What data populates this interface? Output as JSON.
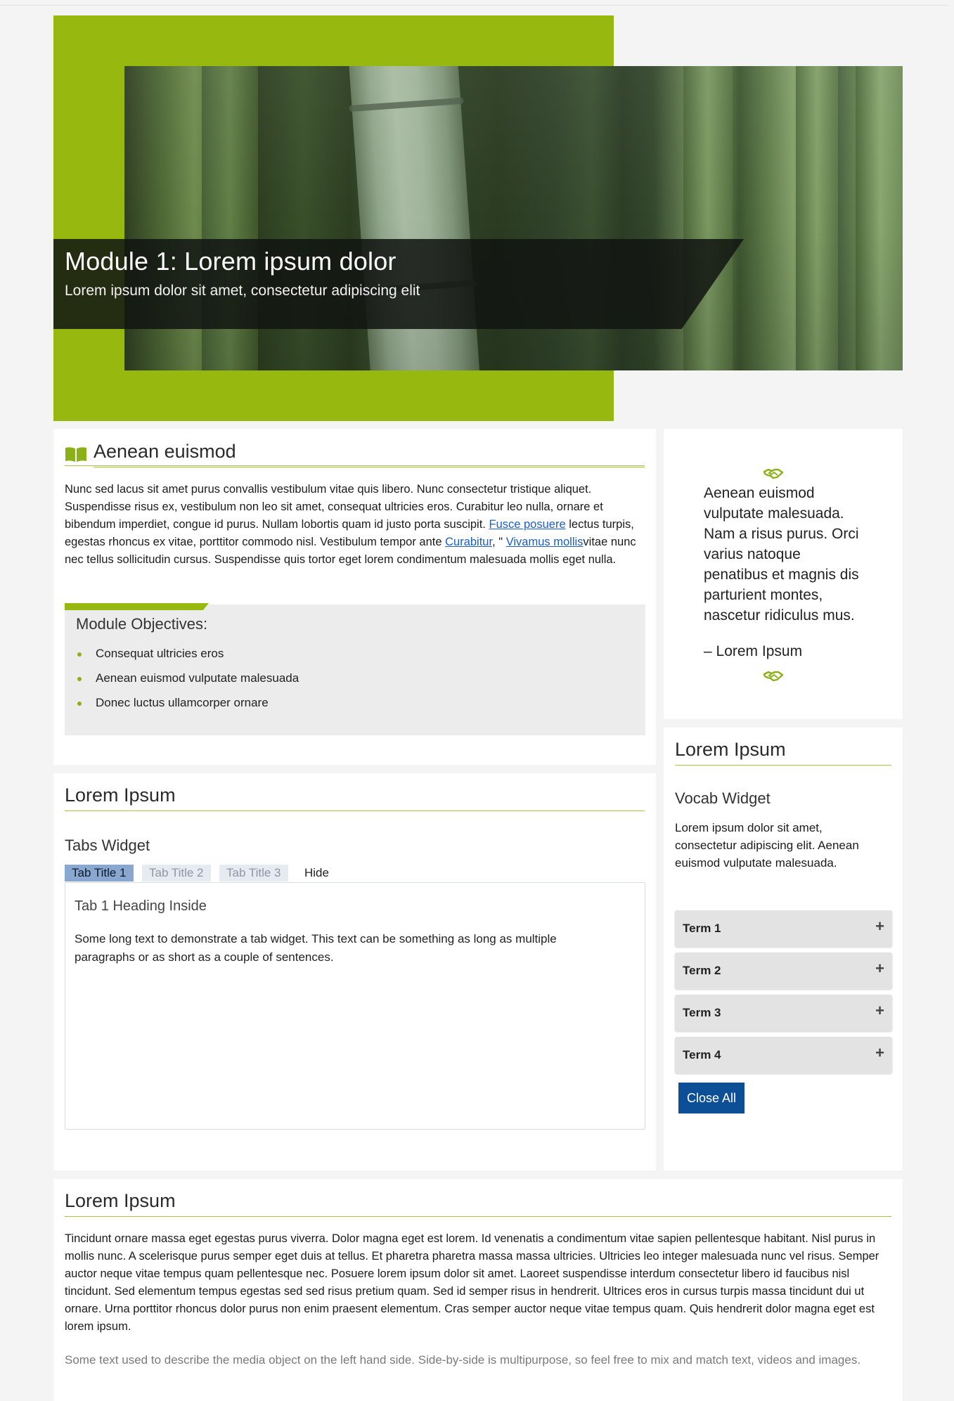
{
  "banner": {
    "title": "Module 1: Lorem ipsum dolor",
    "subtitle": "Lorem ipsum dolor sit amet, consectetur adipiscing elit"
  },
  "intro": {
    "heading": "Aenean euismod",
    "paragraph": {
      "part1": "Nunc sed lacus sit amet purus convallis vestibulum vitae quis libero. Nunc consectetur tristique aliquet. Suspendisse risus ex, vestibulum non leo sit amet, consequat ultricies eros. Curabitur leo nulla, ornare et bibendum imperdiet, congue id purus. Nullam lobortis quam id justo porta suscipit. ",
      "link1": "Fusce posuere",
      "part2": " lectus turpis, egestas rhoncus ex vitae, porttitor commodo nisl. Vestibulum tempor ante ",
      "link2": "Curabitur",
      "part3": ", \" ",
      "link3": "Vivamus mollis",
      "part4": "vitae nunc nec tellus sollicitudin cursus. Suspendisse quis tortor eget lorem condimentum malesuada mollis eget nulla."
    },
    "objectives": {
      "title": "Module Objectives:",
      "items": [
        "Consequat ultricies eros",
        "Aenean euismod vulputate malesuada",
        "Donec luctus ullamcorper ornare"
      ]
    }
  },
  "quote": {
    "text": "Aenean euismod vulputate malesuada. Nam a risus purus. Orci varius natoque penatibus et magnis dis parturient montes, nascetur ridiculus mus.",
    "author": "– Lorem Ipsum",
    "icon": "handshake-icon"
  },
  "tabs_section": {
    "heading": "Lorem Ipsum",
    "widget_title": "Tabs Widget",
    "tabs": [
      "Tab Title 1",
      "Tab Title 2",
      "Tab Title 3"
    ],
    "active_tab": "Tab Title 1",
    "hide_label": "Hide",
    "content": {
      "heading": "Tab 1 Heading Inside",
      "text": "Some long text to demonstrate a tab widget. This text can be something as long as multiple paragraphs or as short as a couple of sentences."
    }
  },
  "vocab_section": {
    "heading": "Lorem Ipsum",
    "widget_title": "Vocab Widget",
    "description": "Lorem ipsum dolor sit amet, consectetur adipiscing elit. Aenean euismod vulputate malesuada.",
    "terms": [
      "Term 1",
      "Term 2",
      "Term 3",
      "Term 4"
    ],
    "expand_symbol": "+",
    "close_all_label": "Close All"
  },
  "bottom_section": {
    "heading": "Lorem Ipsum",
    "paragraph": "Tincidunt ornare massa eget egestas purus viverra. Dolor magna eget est lorem. Id venenatis a condimentum vitae sapien pellentesque habitant. Nisl purus in mollis nunc. A scelerisque purus semper eget duis at tellus. Et pharetra pharetra massa massa ultricies. Ultricies leo integer malesuada nunc vel risus. Semper auctor neque vitae tempus quam pellentesque nec. Posuere lorem ipsum dolor sit amet. Laoreet suspendisse interdum consectetur libero id faucibus nisl tincidunt. Sed elementum tempus egestas sed sed risus pretium quam. Sed id semper risus in hendrerit. Ultrices eros in cursus turpis massa tincidunt dui ut ornare. Urna porttitor rhoncus dolor purus non enim praesent elementum. Cras semper auctor neque vitae tempus quam. Quis hendrerit dolor magna eget est lorem ipsum.",
    "caption": "Some text used to describe the media object on the left hand side. Side-by-side is multipurpose, so feel free to mix and match text, videos and images."
  },
  "colors": {
    "accent_green": "#97b90f",
    "active_tab_blue": "#8aa7cf",
    "button_blue": "#0d4f96",
    "link_blue": "#1a5ec8"
  }
}
